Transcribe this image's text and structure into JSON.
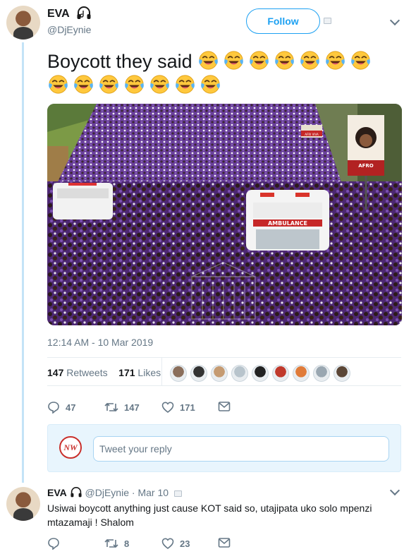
{
  "tweet": {
    "author": {
      "name": "EVA",
      "handle": "@DjEynie",
      "name_icon": "headphones-music-icon"
    },
    "follow_label": "Follow",
    "text": "Boycott they said",
    "emoji": "😂",
    "emoji_count": 14,
    "timestamp": "12:14 AM - 10 Mar 2019",
    "retweets": {
      "count": "147",
      "label": "Retweets"
    },
    "likes": {
      "count": "171",
      "label": "Likes"
    },
    "liker_avatars": 9,
    "actions": {
      "replies": "47",
      "retweets": "147",
      "likes": "171"
    },
    "photo_text": {
      "banner_left": "AFRI VIVA",
      "banner_right": "AFRO",
      "ambulance": "AMBULANCE"
    }
  },
  "reply_composer": {
    "logo": "NW",
    "placeholder": "Tweet your reply"
  },
  "reply": {
    "author": {
      "name": "EVA",
      "handle": "@DjEynie"
    },
    "separator": "·",
    "date": "Mar 10",
    "text": "Usiwai boycott anything just cause KOT said so, utajipata uko solo mpenzi mtazamaji ! Shalom",
    "actions": {
      "replies": "",
      "retweets": "8",
      "likes": "23"
    }
  },
  "colors": {
    "accent": "#1da1f2",
    "muted": "#657786",
    "thread_line": "#c4e3f7",
    "crowd_purple": "#5b2d86"
  }
}
